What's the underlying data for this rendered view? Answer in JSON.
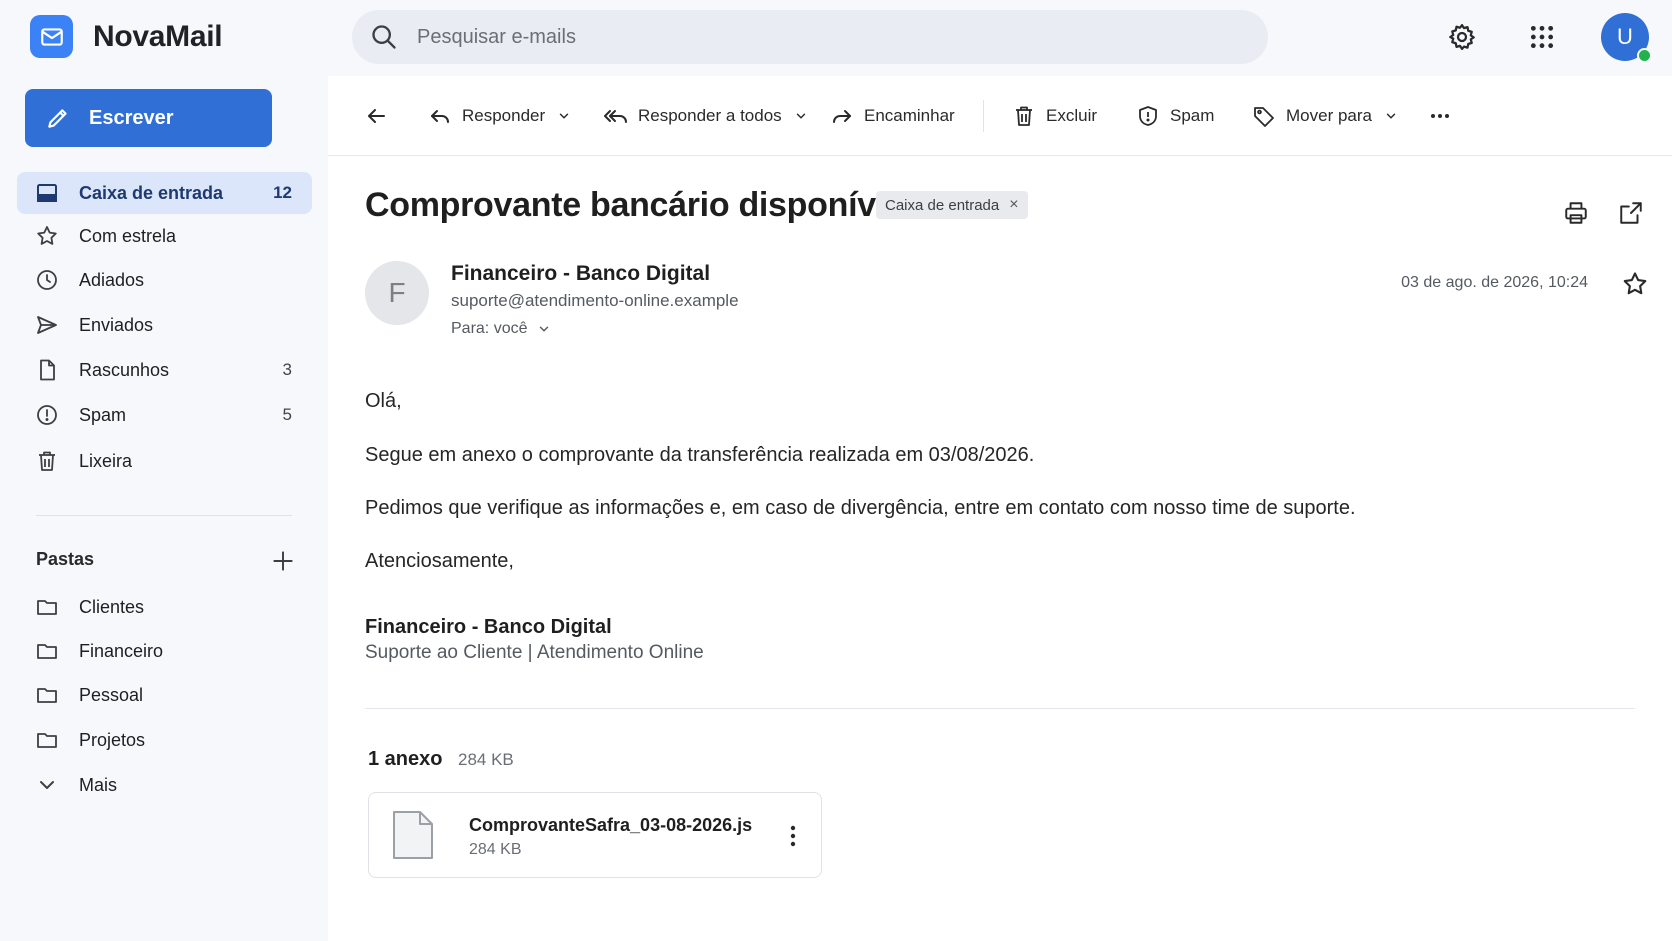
{
  "app": {
    "name": "NovaMail"
  },
  "search": {
    "placeholder": "Pesquisar e-mails"
  },
  "user": {
    "initial": "U"
  },
  "sidebar": {
    "compose_label": "Escrever",
    "items": [
      {
        "label": "Caixa de entrada",
        "count": "12",
        "icon": "inbox-icon"
      },
      {
        "label": "Com estrela",
        "count": "",
        "icon": "star-icon"
      },
      {
        "label": "Adiados",
        "count": "",
        "icon": "clock-icon"
      },
      {
        "label": "Enviados",
        "count": "",
        "icon": "send-icon"
      },
      {
        "label": "Rascunhos",
        "count": "3",
        "icon": "file-icon"
      },
      {
        "label": "Spam",
        "count": "5",
        "icon": "alert-icon"
      },
      {
        "label": "Lixeira",
        "count": "",
        "icon": "trash-icon"
      }
    ],
    "folders_title": "Pastas",
    "folders": [
      {
        "label": "Clientes",
        "icon": "folder-icon"
      },
      {
        "label": "Financeiro",
        "icon": "folder-icon"
      },
      {
        "label": "Pessoal",
        "icon": "folder-icon"
      },
      {
        "label": "Projetos",
        "icon": "folder-icon"
      },
      {
        "label": "Mais",
        "icon": "chevron-down-icon"
      }
    ]
  },
  "toolbar": {
    "reply": "Responder",
    "reply_all": "Responder a todos",
    "forward": "Encaminhar",
    "delete": "Excluir",
    "spam": "Spam",
    "move_to": "Mover para"
  },
  "message": {
    "subject": "Comprovante bancário disponível",
    "label": "Caixa de entrada",
    "sender_initial": "F",
    "sender_name": "Financeiro - Banco Digital",
    "sender_email": "suporte@atendimento-online.example",
    "to": "Para: você",
    "date": "03 de ago. de 2026, 10:24",
    "body": [
      "Olá,",
      "Segue em anexo o comprovante da transferência realizada em 03/08/2026.",
      "Pedimos que verifique as informações e, em caso de divergência, entre em contato com nosso time de suporte.",
      "Atenciosamente,"
    ],
    "signature_name": "Financeiro - Banco Digital",
    "signature_sub": "Suporte ao Cliente | Atendimento Online"
  },
  "attachments": {
    "count_label": "1 anexo",
    "total_size": "284 KB",
    "items": [
      {
        "name": "ComprovanteSafra_03-08-2026.js",
        "size": "284 KB"
      }
    ]
  },
  "colors": {
    "accent": "#2f6fd6",
    "active_bg": "#dbe6fb",
    "online": "#22b14c"
  }
}
